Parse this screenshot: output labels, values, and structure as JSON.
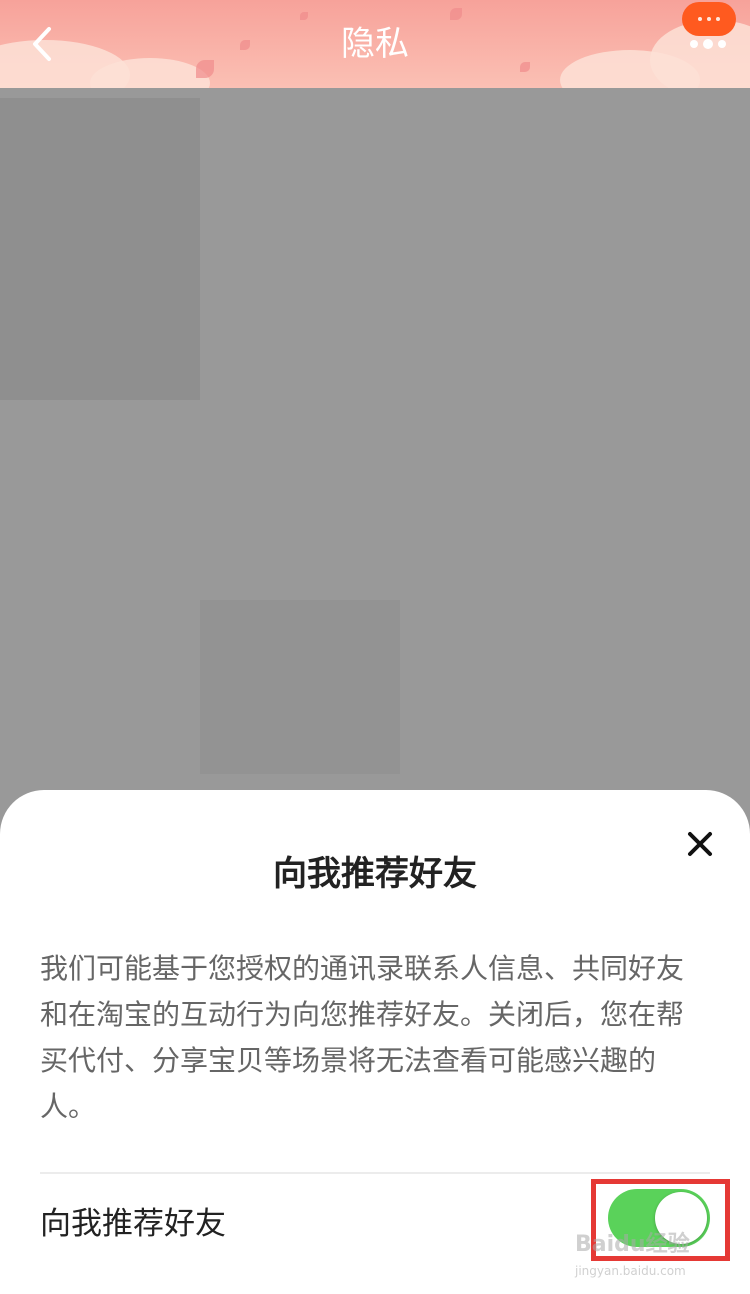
{
  "nav": {
    "title": "隐私",
    "back_icon": "chevron-left-icon",
    "more_icon": "more-dots-icon",
    "accent_color": "#ff5a1f"
  },
  "sheet": {
    "title": "向我推荐好友",
    "description": "我们可能基于您授权的通讯录联系人信息、共同好友和在淘宝的互动行为向您推荐好友。关闭后，您在帮买代付、分享宝贝等场景将无法查看可能感兴趣的人。",
    "close_icon": "close-icon",
    "setting": {
      "label": "向我推荐好友",
      "enabled": true,
      "toggle_color": "#5ad25a"
    }
  },
  "watermark": {
    "text": "Baidu经验",
    "subtext": "jingyan.baidu.com"
  }
}
